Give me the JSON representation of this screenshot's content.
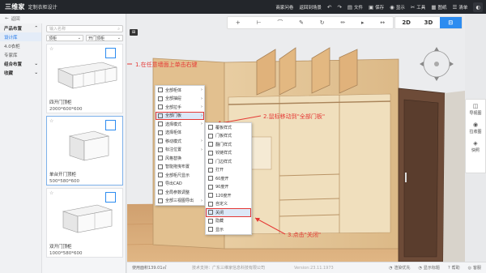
{
  "app": {
    "logo": "三维家",
    "subtitle": "定制衣柜设计"
  },
  "topmenu": [
    {
      "label": "商家问卷",
      "icon": ""
    },
    {
      "label": "返回到场景",
      "icon": ""
    },
    {
      "label": "",
      "icon": "↶"
    },
    {
      "label": "",
      "icon": "↷"
    },
    {
      "label": "文件",
      "icon": "▤"
    },
    {
      "label": "保存",
      "icon": "💾"
    },
    {
      "label": "显示",
      "icon": "◉"
    },
    {
      "label": "工具",
      "icon": "✂"
    },
    {
      "label": "图纸",
      "icon": "▦"
    },
    {
      "label": "清单",
      "icon": "☰"
    },
    {
      "label": "",
      "icon": "◐"
    }
  ],
  "left": {
    "back": "返回",
    "categories": [
      {
        "label": "产品布置",
        "head": true,
        "active": false
      },
      {
        "label": "设计库",
        "head": false,
        "active": true
      },
      {
        "label": "4.0衣柜",
        "head": false,
        "active": false
      },
      {
        "label": "专家库",
        "head": false,
        "active": false
      },
      {
        "label": "组合布置",
        "head": true,
        "active": false
      },
      {
        "label": "收藏",
        "head": true,
        "active": false
      }
    ],
    "search_placeholder": "输入名称",
    "filter1": "顶柜",
    "filter2": "开门顶柜",
    "products": [
      {
        "name": "四开门顶柜",
        "size": "2000*600*600"
      },
      {
        "name": "单台开门顶柜",
        "size": "500*580*600"
      },
      {
        "name": "双开门顶柜",
        "size": "1000*580*600"
      }
    ]
  },
  "canvas": {
    "tag": "⊞",
    "toolbar_icons": [
      "+",
      "⊢",
      "⌒",
      "✎",
      "↻",
      "✏",
      "▸",
      "↔"
    ],
    "views": [
      "2D",
      "3D",
      "⊟"
    ],
    "active_view": 2
  },
  "annotations": {
    "a1": "1.在任意墙面上单击右键",
    "a2": "2.鼠标移动到\"全部门板\"",
    "a3": "3.点击\"关闭\""
  },
  "context_menu": [
    {
      "label": "全部柜体",
      "arrow": true
    },
    {
      "label": "全部抽屉",
      "arrow": true
    },
    {
      "label": "全部拉手",
      "arrow": true
    },
    {
      "label": "全部门板",
      "arrow": true,
      "hl": true
    },
    {
      "label": "选择模式",
      "arrow": true
    },
    {
      "label": "选择柜体",
      "arrow": false
    },
    {
      "label": "移动模式",
      "arrow": true
    },
    {
      "label": "标注位置",
      "arrow": true
    },
    {
      "label": "风格替换",
      "arrow": false
    },
    {
      "label": "智能拖曳布置",
      "arrow": false
    },
    {
      "label": "全部柜尺显示",
      "arrow": false
    },
    {
      "label": "导出CAD",
      "arrow": false
    },
    {
      "label": "全局参数调整",
      "arrow": false
    },
    {
      "label": "全部三视图导出",
      "arrow": true
    }
  ],
  "submenu": [
    {
      "label": "覆板样式",
      "boxed": false
    },
    {
      "label": "门板样式",
      "boxed": false
    },
    {
      "label": "翻门样式",
      "boxed": false
    },
    {
      "label": "铰链样式",
      "boxed": false
    },
    {
      "label": "门边样式",
      "boxed": false
    },
    {
      "label": "打开",
      "boxed": false
    },
    {
      "label": "60度开",
      "boxed": false
    },
    {
      "label": "90度开",
      "boxed": false
    },
    {
      "label": "120度开",
      "boxed": false
    },
    {
      "label": "自定义",
      "boxed": false
    },
    {
      "label": "关闭",
      "boxed": true
    },
    {
      "label": "隐藏",
      "boxed": false
    },
    {
      "label": "显示",
      "boxed": false
    }
  ],
  "righttools": [
    {
      "label": "导视图",
      "icon": "◫"
    },
    {
      "label": "拉收图",
      "icon": "◉"
    },
    {
      "label": "快照",
      "icon": "◈"
    }
  ],
  "status": {
    "area": "使用面积139.01㎡",
    "support": "技术支持：广东三维家信息科技有限公司",
    "version": "Version:23.11.1973",
    "right": [
      "渲染优先",
      "显示标题",
      "帮助",
      "客服"
    ]
  },
  "colors": {
    "accent": "#2d8cf0",
    "annotation": "#e53935",
    "topbar": "#23262b"
  }
}
